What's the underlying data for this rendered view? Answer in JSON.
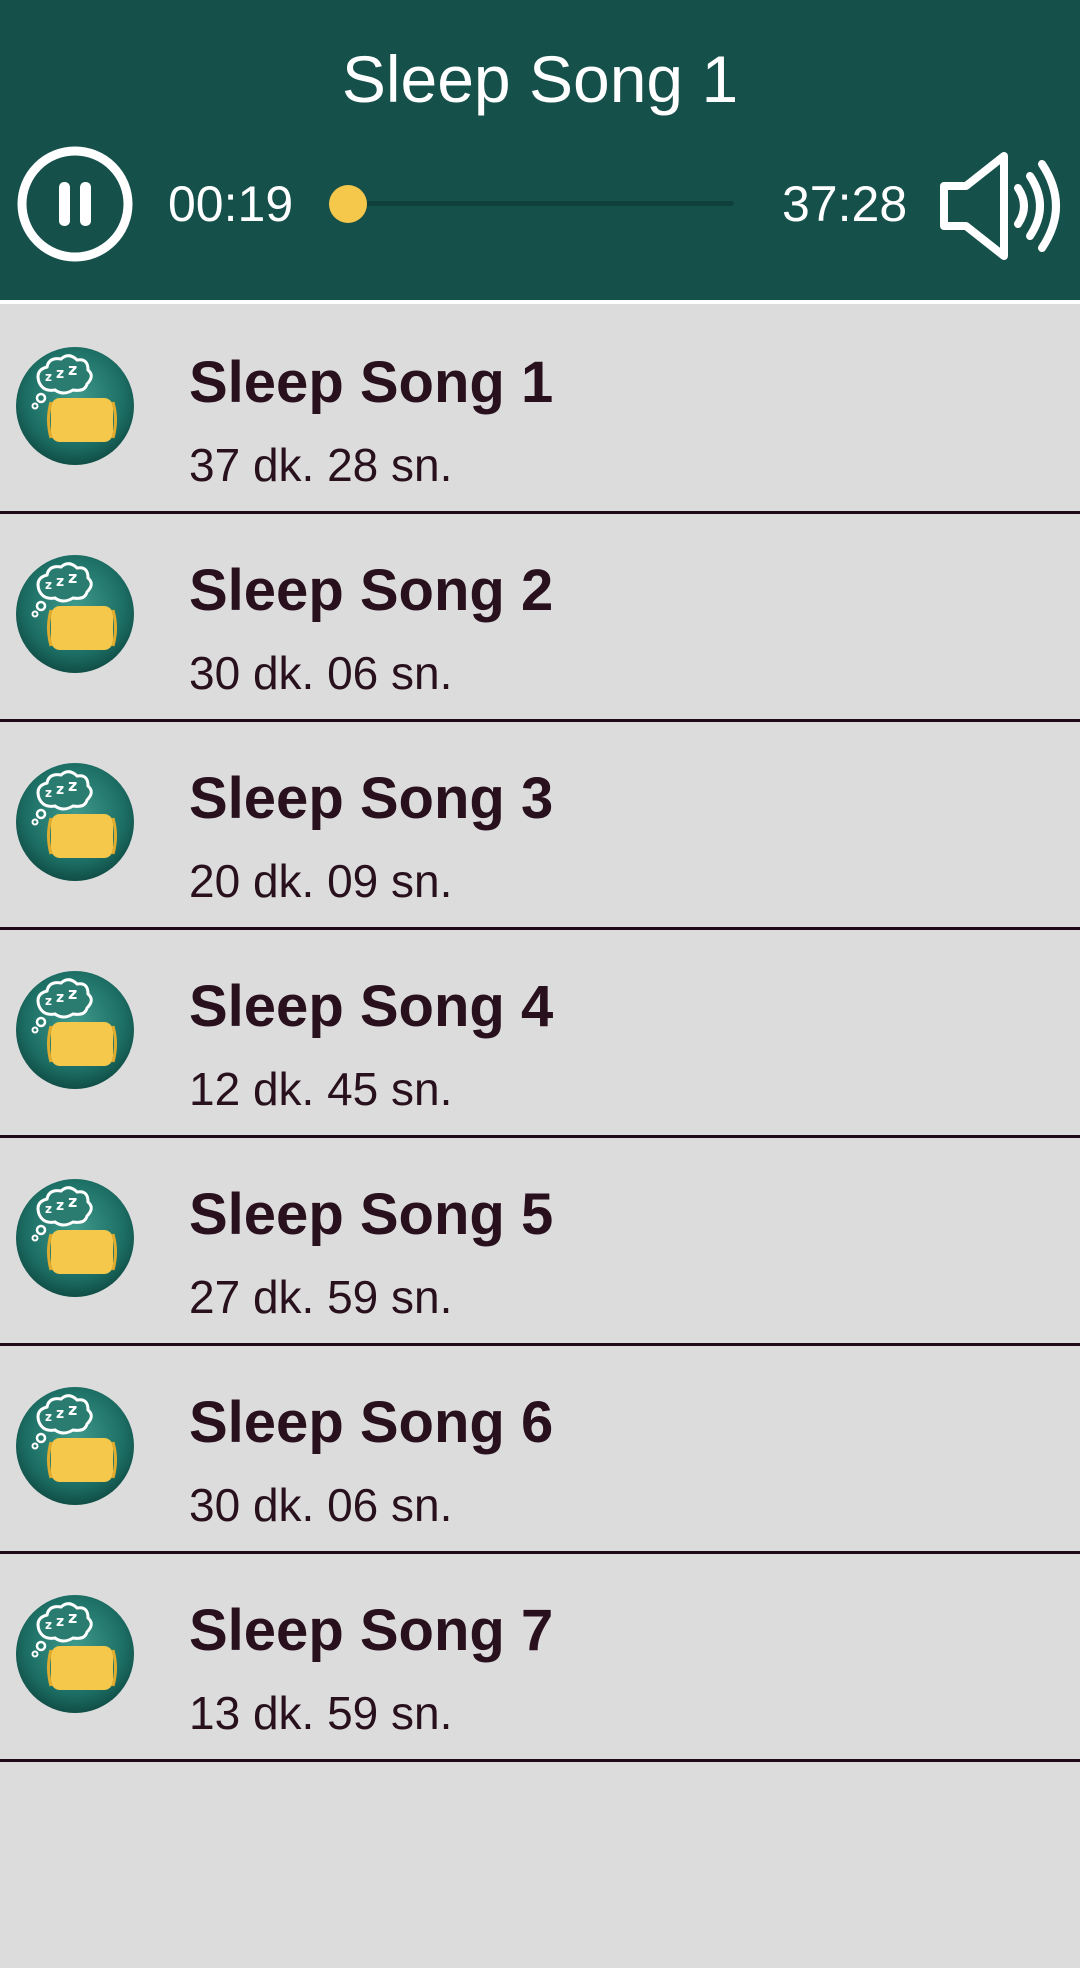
{
  "player": {
    "now_playing_title": "Sleep Song 1",
    "elapsed": "00:19",
    "total": "37:28",
    "progress_fraction": 0.008,
    "state": "playing",
    "pause_icon": "pause-icon",
    "volume_icon": "speaker-volume-icon",
    "accent_color": "#f5c74a",
    "bar_color": "#16504b"
  },
  "songs": [
    {
      "title": "Sleep Song 1",
      "duration": "37 dk. 28 sn.",
      "icon": "sleep-pillow-icon"
    },
    {
      "title": "Sleep Song 2",
      "duration": "30 dk. 06 sn.",
      "icon": "sleep-pillow-icon"
    },
    {
      "title": "Sleep Song 3",
      "duration": "20 dk. 09 sn.",
      "icon": "sleep-pillow-icon"
    },
    {
      "title": "Sleep Song 4",
      "duration": "12 dk. 45 sn.",
      "icon": "sleep-pillow-icon"
    },
    {
      "title": "Sleep Song 5",
      "duration": "27 dk. 59 sn.",
      "icon": "sleep-pillow-icon"
    },
    {
      "title": "Sleep Song 6",
      "duration": "30 dk. 06 sn.",
      "icon": "sleep-pillow-icon"
    },
    {
      "title": "Sleep Song 7",
      "duration": "13 dk. 59 sn.",
      "icon": "sleep-pillow-icon"
    }
  ]
}
